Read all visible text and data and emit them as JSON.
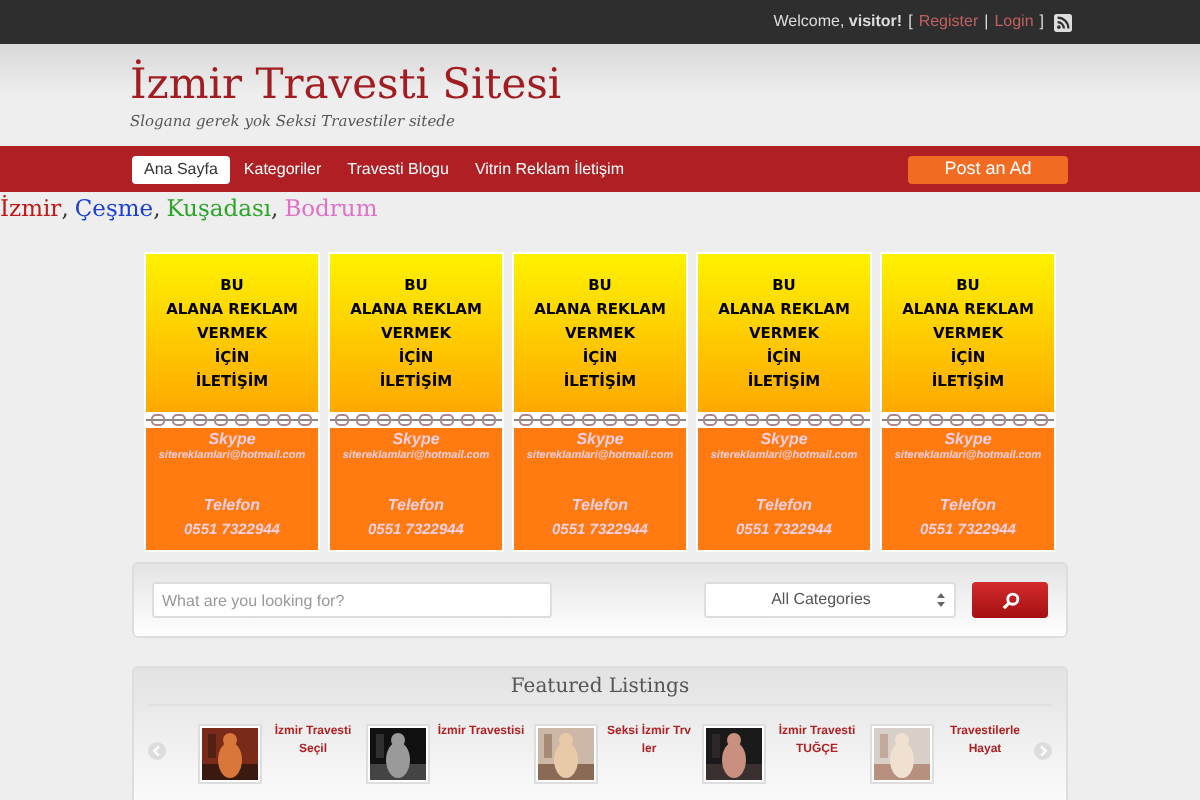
{
  "top_bar": {
    "welcome": "Welcome, **visitor!**",
    "open_bracket": "[",
    "links": [
      {
        "label": "Register"
      },
      {
        "label": "Login"
      }
    ],
    "separator": "|",
    "close_bracket": "]"
  },
  "header": {
    "title": "İzmir Travesti Sitesi",
    "slogan": "Slogana gerek yok Seksi Travestiler sitede"
  },
  "nav": {
    "items": [
      {
        "label": "Ana Sayfa",
        "selected": true
      },
      {
        "label": "Kategoriler",
        "selected": false
      },
      {
        "label": "Travesti Blogu",
        "selected": false
      },
      {
        "label": "Vitrin Reklam İletişim",
        "selected": false
      }
    ],
    "post_button": "Post an Ad"
  },
  "cities": [
    {
      "label": "İzmir",
      "color": "#c01818"
    },
    {
      "label": "Çeşme",
      "color": "#1c3fd6"
    },
    {
      "label": "Kuşadası",
      "color": "#2aa52a"
    },
    {
      "label": "Bodrum",
      "color": "#e070c8"
    }
  ],
  "city_separator": ",",
  "ads": [
    {
      "headline": [
        "BU",
        "ALANA REKLAM",
        "VERMEK",
        "İÇİN",
        "İLETİŞİM"
      ],
      "contact": [
        "Skype",
        "sitereklamlari@hotmail.com",
        "Telefon",
        "0551 7322944"
      ]
    },
    {
      "headline": [
        "BU",
        "ALANA REKLAM",
        "VERMEK",
        "İÇİN",
        "İLETİŞİM"
      ],
      "contact": [
        "Skype",
        "sitereklamlari@hotmail.com",
        "Telefon",
        "0551 7322944"
      ]
    },
    {
      "headline": [
        "BU",
        "ALANA REKLAM",
        "VERMEK",
        "İÇİN",
        "İLETİŞİM"
      ],
      "contact": [
        "Skype",
        "sitereklamlari@hotmail.com",
        "Telefon",
        "0551 7322944"
      ]
    },
    {
      "headline": [
        "BU",
        "ALANA REKLAM",
        "VERMEK",
        "İÇİN",
        "İLETİŞİM"
      ],
      "contact": [
        "Skype",
        "sitereklamlari@hotmail.com",
        "Telefon",
        "0551 7322944"
      ]
    },
    {
      "headline": [
        "BU",
        "ALANA REKLAM",
        "VERMEK",
        "İÇİN",
        "İLETİŞİM"
      ],
      "contact": [
        "Skype",
        "sitereklamlari@hotmail.com",
        "Telefon",
        "0551 7322944"
      ]
    }
  ],
  "search": {
    "placeholder": "What are you looking for?",
    "category": "All Categories"
  },
  "featured": {
    "title": "Featured Listings",
    "listings": [
      {
        "title": "İzmir Travesti Seçil",
        "kind": "picture"
      },
      {
        "title": "İzmir Travestisi",
        "kind": "picture"
      },
      {
        "title": "Seksi İzmir Trv ler",
        "kind": "picture"
      },
      {
        "title": "İzmir Travesti TUĞÇE",
        "kind": "picture"
      },
      {
        "title": "Travestilerle Hayat",
        "kind": "picture"
      }
    ]
  }
}
